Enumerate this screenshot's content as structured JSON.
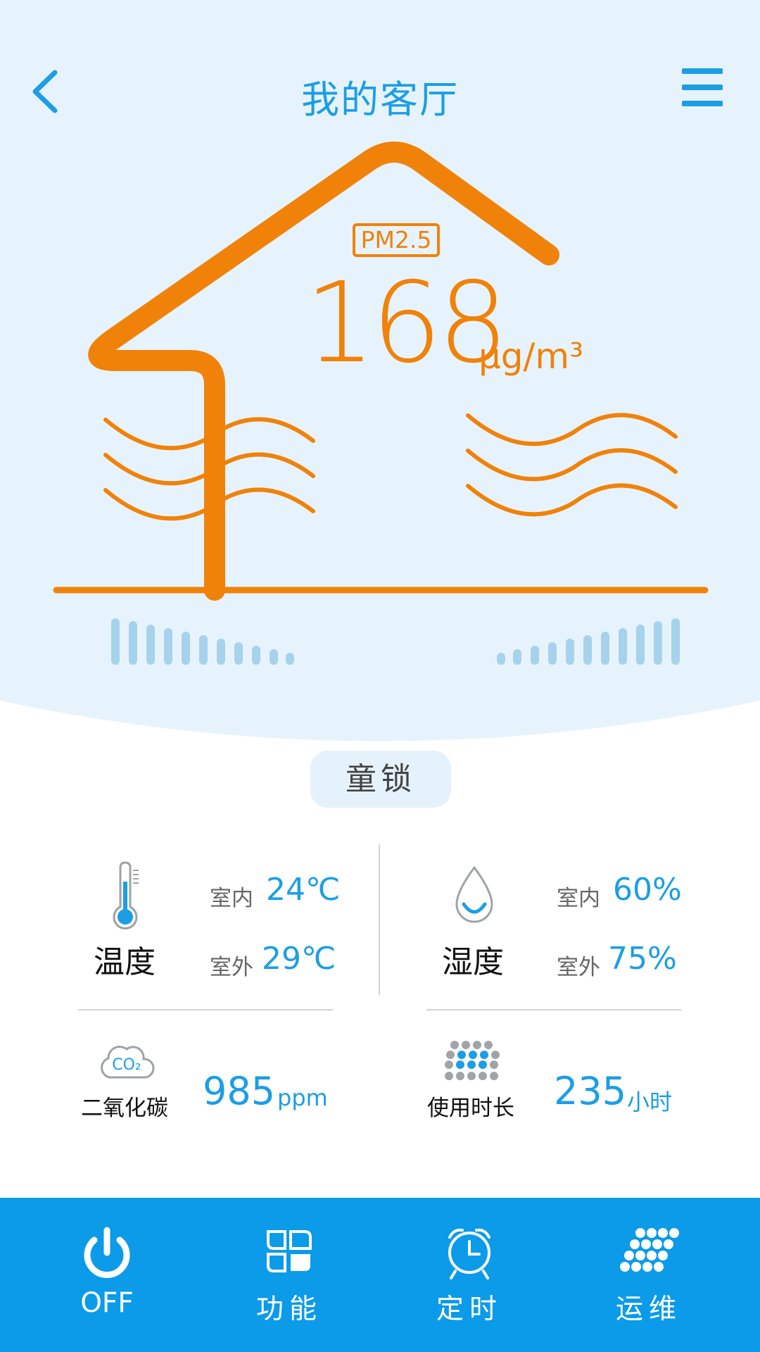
{
  "header": {
    "title": "我的客厅"
  },
  "pm": {
    "label": "PM2.5",
    "value": "168",
    "unit": "μg/m³"
  },
  "child_lock": {
    "label": "童锁"
  },
  "temperature": {
    "name": "温度",
    "indoor_label": "室内",
    "indoor_value": "24℃",
    "outdoor_label": "室外",
    "outdoor_value": "29℃"
  },
  "humidity": {
    "name": "湿度",
    "indoor_label": "室内",
    "indoor_value": "60%",
    "outdoor_label": "室外",
    "outdoor_value": "75%"
  },
  "co2": {
    "name": "二氧化碳",
    "icon_text": "CO₂",
    "value": "985",
    "unit": "ppm"
  },
  "usage": {
    "name": "使用时长",
    "value": "235",
    "unit": "小时"
  },
  "nav": [
    {
      "label": "OFF",
      "icon": "power-icon"
    },
    {
      "label": "功能",
      "icon": "function-grid-icon"
    },
    {
      "label": "定时",
      "icon": "alarm-clock-icon"
    },
    {
      "label": "运维",
      "icon": "maintenance-hex-icon"
    }
  ],
  "colors": {
    "accent": "#1b9ee6",
    "orange": "#f0820a",
    "hero_bg": "#e7f3fc",
    "navbar": "#0b9be9"
  }
}
